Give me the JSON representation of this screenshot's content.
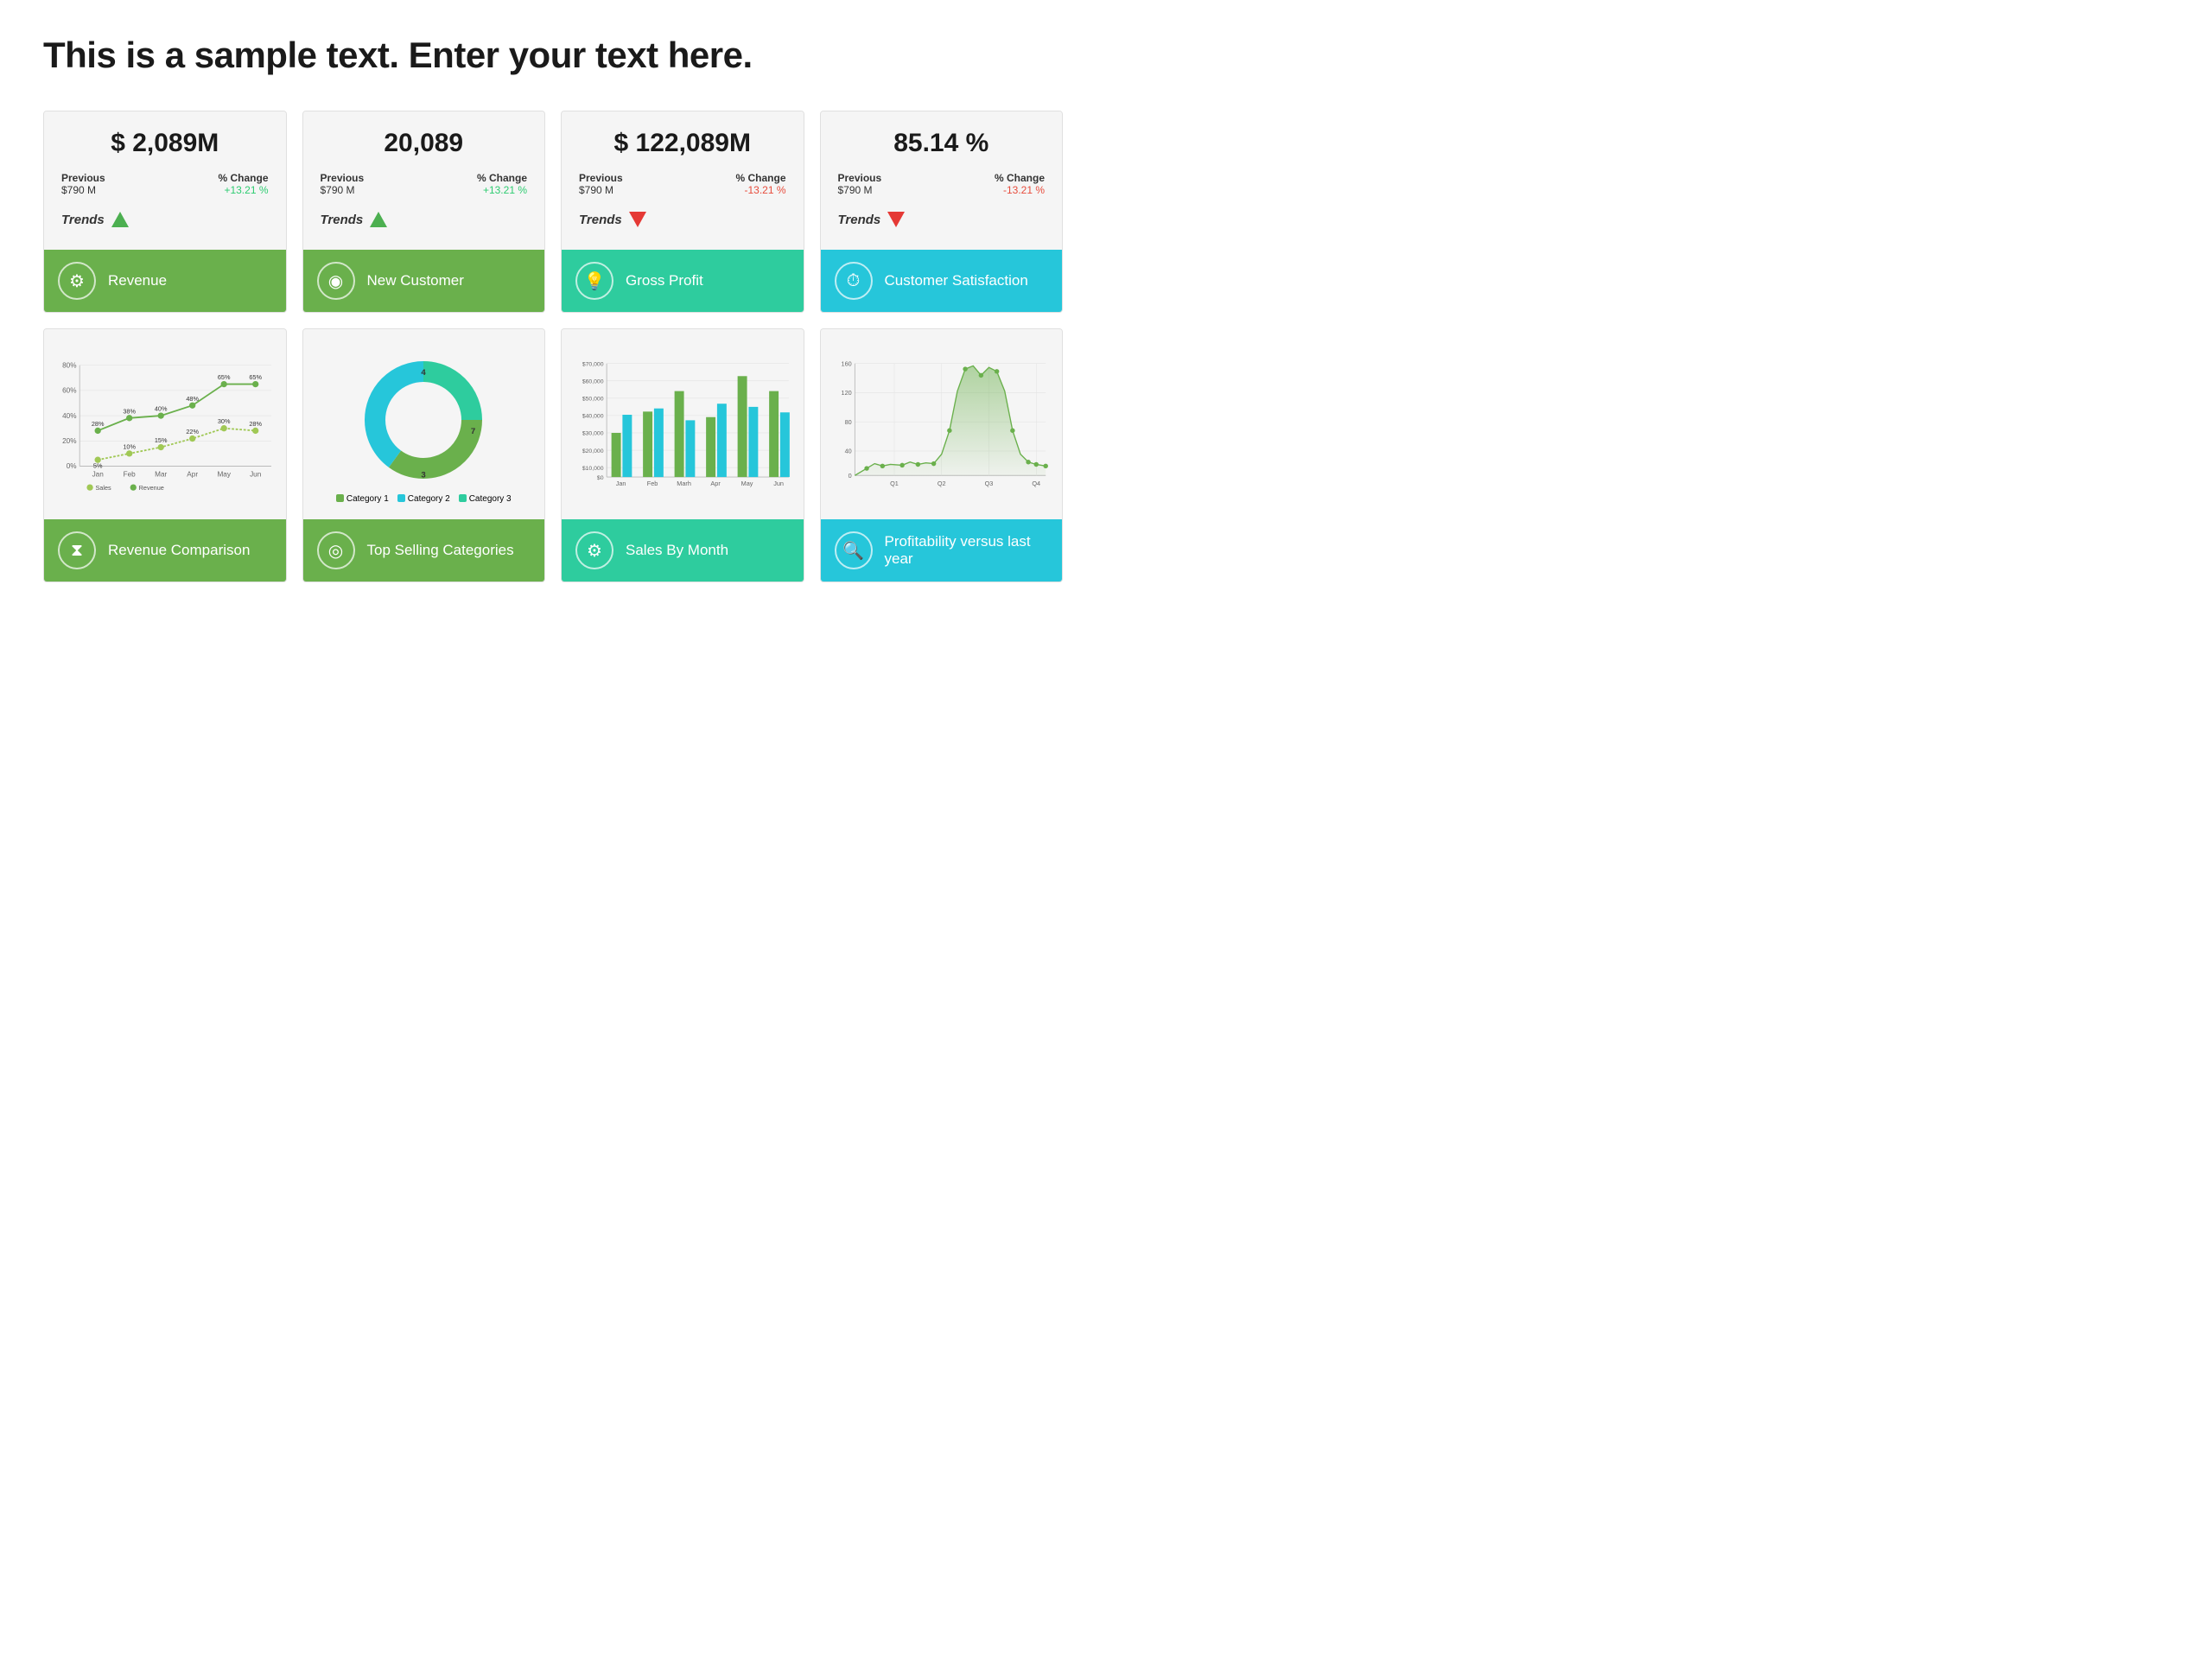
{
  "title": "This is a sample text. Enter your text here.",
  "kpis": [
    {
      "value": "$ 2,089M",
      "previous_label": "Previous",
      "previous_value": "$790 M",
      "change_label": "% Change",
      "change_value": "+13.21 %",
      "change_positive": true,
      "trends_label": "Trends",
      "footer_label": "Revenue",
      "footer_color": "green",
      "footer_icon": "⚙"
    },
    {
      "value": "20,089",
      "previous_label": "Previous",
      "previous_value": "$790 M",
      "change_label": "% Change",
      "change_value": "+13.21 %",
      "change_positive": true,
      "trends_label": "Trends",
      "footer_label": "New Customer",
      "footer_color": "green",
      "footer_icon": "◉"
    },
    {
      "value": "$ 122,089M",
      "previous_label": "Previous",
      "previous_value": "$790 M",
      "change_label": "% Change",
      "change_value": "-13.21 %",
      "change_positive": false,
      "trends_label": "Trends",
      "footer_label": "Gross Profit",
      "footer_color": "teal",
      "footer_icon": "💡"
    },
    {
      "value": "85.14 %",
      "previous_label": "Previous",
      "previous_value": "$790 M",
      "change_label": "% Change",
      "change_value": "-13.21 %",
      "change_positive": false,
      "trends_label": "Trends",
      "footer_label": "Customer Satisfaction",
      "footer_color": "cyan",
      "footer_icon": "⏱"
    }
  ],
  "charts": [
    {
      "footer_label": "Revenue Comparison",
      "footer_color": "green",
      "footer_icon": "⧗",
      "type": "line"
    },
    {
      "footer_label": "Top Selling Categories",
      "footer_color": "green",
      "footer_icon": "◎",
      "type": "donut"
    },
    {
      "footer_label": "Sales By Month",
      "footer_color": "teal",
      "footer_icon": "⚙",
      "type": "bar"
    },
    {
      "footer_label": "Profitability versus last year",
      "footer_color": "cyan",
      "footer_icon": "🔍",
      "type": "area"
    }
  ],
  "line_chart": {
    "months": [
      "Jan",
      "Feb",
      "Mar",
      "Apr",
      "May",
      "Jun"
    ],
    "sales": [
      5,
      10,
      15,
      22,
      30,
      28
    ],
    "revenue": [
      28,
      38,
      40,
      48,
      65,
      65
    ],
    "y_labels": [
      "0%",
      "20%",
      "40%",
      "60%",
      "80%"
    ]
  },
  "donut_chart": {
    "segments": [
      {
        "label": "Category 1",
        "value": 35,
        "color": "#6ab04c"
      },
      {
        "label": "Category 2",
        "value": 40,
        "color": "#26c6da"
      },
      {
        "label": "Category 3",
        "value": 25,
        "color": "#2ecc9e"
      }
    ],
    "labels": [
      "4",
      "7",
      "3"
    ]
  },
  "bar_chart": {
    "months": [
      "Jan",
      "Feb",
      "Marh",
      "Apr",
      "May",
      "Jun"
    ],
    "series1": [
      27000,
      40000,
      53000,
      37000,
      62000,
      53000
    ],
    "series2": [
      38000,
      42000,
      35000,
      45000,
      43000,
      40000
    ],
    "y_labels": [
      "$0",
      "$10,000",
      "$20,000",
      "$30,000",
      "$40,000",
      "$50,000",
      "$60,000",
      "$70,000"
    ],
    "color1": "#6ab04c",
    "color2": "#26c6da"
  },
  "area_chart": {
    "quarters": [
      "Q1",
      "Q2",
      "Q3",
      "Q4"
    ],
    "y_labels": [
      "0",
      "40",
      "80",
      "120",
      "160"
    ],
    "color": "#6ab04c"
  }
}
